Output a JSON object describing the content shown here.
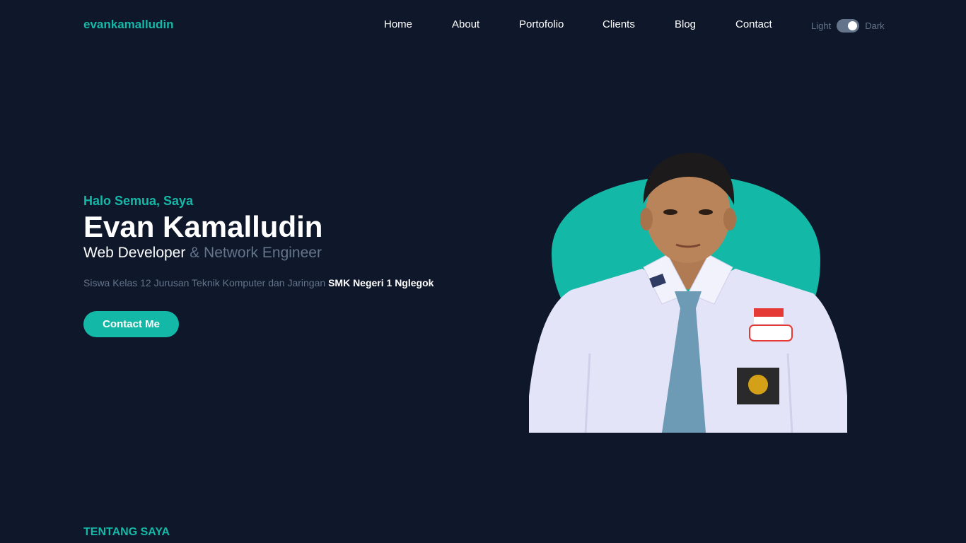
{
  "header": {
    "logo": "evankamalludin",
    "nav": [
      "Home",
      "About",
      "Portofolio",
      "Clients",
      "Blog",
      "Contact"
    ],
    "theme_toggle": {
      "light_label": "Light",
      "dark_label": "Dark",
      "state": "dark"
    }
  },
  "hero": {
    "intro": "Halo Semua, Saya",
    "name": "Evan Kamalludin",
    "role_primary": "Web Developer",
    "role_secondary": "& Network Engineer",
    "description": "Siswa Kelas 12 Jurusan Teknik Komputer dan Jaringan",
    "school": "SMK Negeri 1 Nglegok",
    "cta_label": "Contact Me"
  },
  "about": {
    "section_label": "TENTANG SAYA"
  },
  "colors": {
    "background": "#0f172a",
    "accent": "#14b8a6",
    "muted": "#64748b",
    "text": "#ffffff"
  }
}
